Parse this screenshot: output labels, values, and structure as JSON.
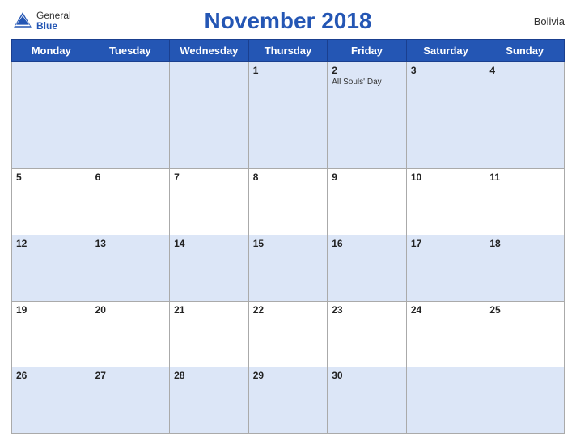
{
  "header": {
    "title": "November 2018",
    "country": "Bolivia",
    "logo_general": "General",
    "logo_blue": "Blue"
  },
  "weekdays": [
    "Monday",
    "Tuesday",
    "Wednesday",
    "Thursday",
    "Friday",
    "Saturday",
    "Sunday"
  ],
  "weeks": [
    [
      {
        "day": "",
        "holiday": ""
      },
      {
        "day": "",
        "holiday": ""
      },
      {
        "day": "",
        "holiday": ""
      },
      {
        "day": "1",
        "holiday": ""
      },
      {
        "day": "2",
        "holiday": "All Souls' Day"
      },
      {
        "day": "3",
        "holiday": ""
      },
      {
        "day": "4",
        "holiday": ""
      }
    ],
    [
      {
        "day": "5",
        "holiday": ""
      },
      {
        "day": "6",
        "holiday": ""
      },
      {
        "day": "7",
        "holiday": ""
      },
      {
        "day": "8",
        "holiday": ""
      },
      {
        "day": "9",
        "holiday": ""
      },
      {
        "day": "10",
        "holiday": ""
      },
      {
        "day": "11",
        "holiday": ""
      }
    ],
    [
      {
        "day": "12",
        "holiday": ""
      },
      {
        "day": "13",
        "holiday": ""
      },
      {
        "day": "14",
        "holiday": ""
      },
      {
        "day": "15",
        "holiday": ""
      },
      {
        "day": "16",
        "holiday": ""
      },
      {
        "day": "17",
        "holiday": ""
      },
      {
        "day": "18",
        "holiday": ""
      }
    ],
    [
      {
        "day": "19",
        "holiday": ""
      },
      {
        "day": "20",
        "holiday": ""
      },
      {
        "day": "21",
        "holiday": ""
      },
      {
        "day": "22",
        "holiday": ""
      },
      {
        "day": "23",
        "holiday": ""
      },
      {
        "day": "24",
        "holiday": ""
      },
      {
        "day": "25",
        "holiday": ""
      }
    ],
    [
      {
        "day": "26",
        "holiday": ""
      },
      {
        "day": "27",
        "holiday": ""
      },
      {
        "day": "28",
        "holiday": ""
      },
      {
        "day": "29",
        "holiday": ""
      },
      {
        "day": "30",
        "holiday": ""
      },
      {
        "day": "",
        "holiday": ""
      },
      {
        "day": "",
        "holiday": ""
      }
    ]
  ]
}
